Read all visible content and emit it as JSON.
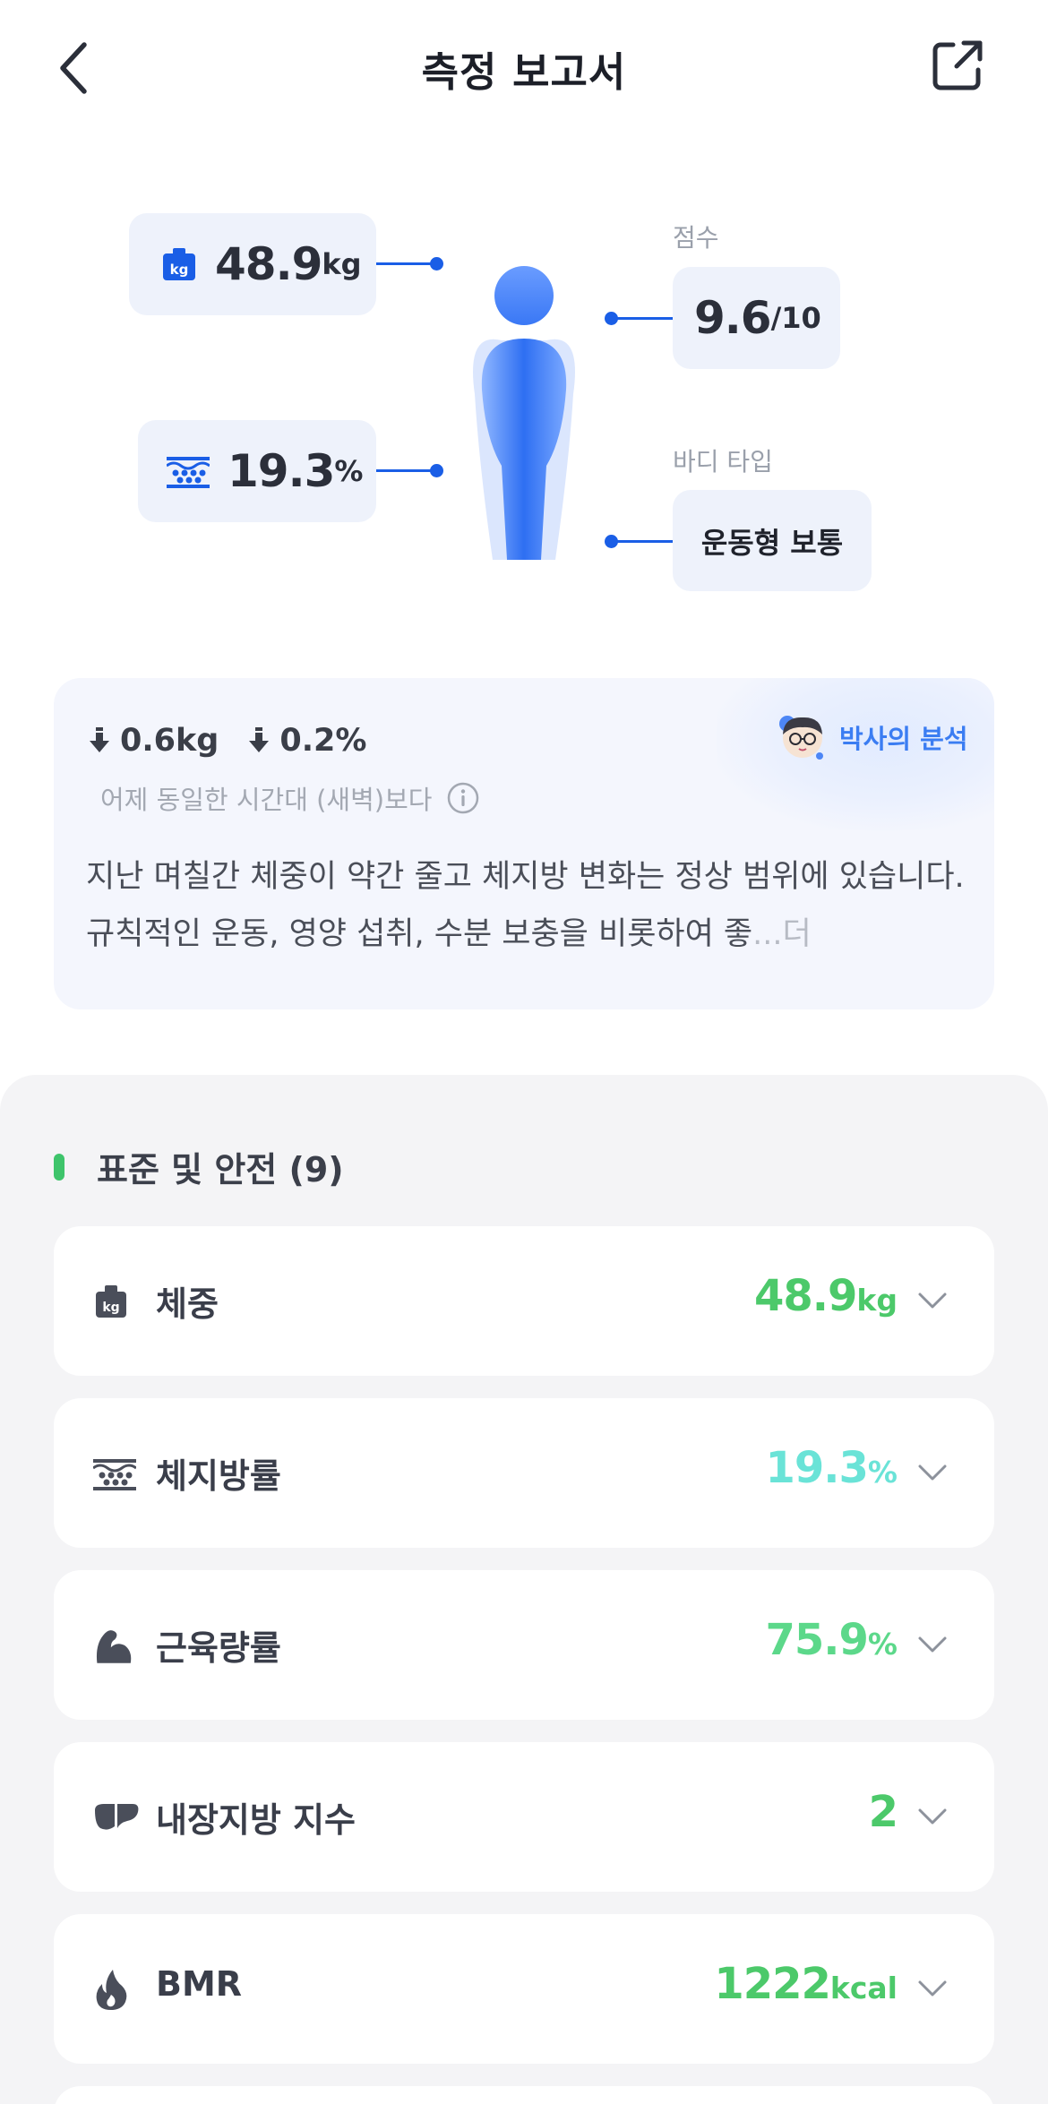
{
  "header": {
    "title": "측정 보고서"
  },
  "figure": {
    "weight_value": "48.9",
    "weight_unit": "kg",
    "fat_value": "19.3",
    "fat_unit": "%",
    "score_label": "점수",
    "score_value": "9.6",
    "score_unit": "/10",
    "body_type_label": "바디 타입",
    "body_type_value": "운동형 보통",
    "accent_color": "#1a5ee6"
  },
  "analysis": {
    "weight_delta": "0.6kg",
    "fat_delta": "0.2%",
    "compare_text": "어제 동일한 시간대 (새벽)보다",
    "doctor_label": "박사의 분석",
    "summary_text": "지난 며칠간 체중이 약간 줄고 체지방 변화는 정상 범위에 있습니다. 규칙적인 운동, 영양 섭취, 수분 보충을 비롯하여 좋",
    "more_text": "...더"
  },
  "section": {
    "title": "표준 및 안전 (9)",
    "marker_color": "#3ec46b"
  },
  "metrics": [
    {
      "icon": "weight-icon",
      "name": "체중",
      "value": "48.9",
      "unit": "kg",
      "color": "#4cc96a"
    },
    {
      "icon": "body-fat-icon",
      "name": "체지방률",
      "value": "19.3",
      "unit": "%",
      "color": "#6ae3d7"
    },
    {
      "icon": "muscle-icon",
      "name": "근육량률",
      "value": "75.9",
      "unit": "%",
      "color": "#5cd88a"
    },
    {
      "icon": "visceral-fat-icon",
      "name": "내장지방 지수",
      "value": "2",
      "unit": "",
      "color": "#4cc96a"
    },
    {
      "icon": "flame-icon",
      "name": "BMR",
      "value": "1222",
      "unit": "kcal",
      "color": "#4cc96a"
    }
  ]
}
